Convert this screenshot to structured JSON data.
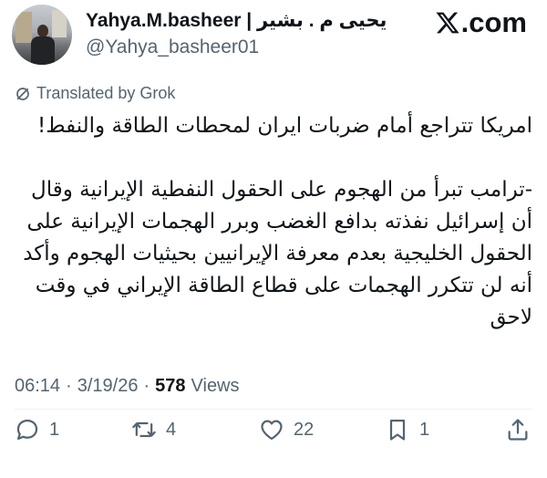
{
  "author": {
    "display_name": "Yahya.M.basheer | يحيى م . بشير",
    "handle": "@Yahya_basheer01"
  },
  "brand": {
    "site": ".com",
    "logo_icon": "x-logo-icon"
  },
  "translation_label": "Translated by Grok",
  "tweet": {
    "headline": "امريكا تتراجع أمام ضربات ايران لمحطات الطاقة والنفط!",
    "body": "-ترامب تبرأ من الهجوم على الحقول النفطية الإيرانية وقال أن إسرائيل نفذته بدافع الغضب وبرر الهجمات الإيرانية على الحقول الخليجية بعدم معرفة الإيرانيين بحيثيات الهجوم وأكد أنه لن تتكرر الهجمات على قطاع الطاقة الإيراني في وقت لاحق"
  },
  "meta": {
    "time": "06:14",
    "date": "3/19/26",
    "separator": "·",
    "views_count": "578",
    "views_label": "Views"
  },
  "actions": {
    "replies": "1",
    "reposts": "4",
    "likes": "22",
    "bookmarks": "1"
  },
  "colors": {
    "text": "#0f1419",
    "secondary": "#536471",
    "divider": "#eff3f4"
  }
}
